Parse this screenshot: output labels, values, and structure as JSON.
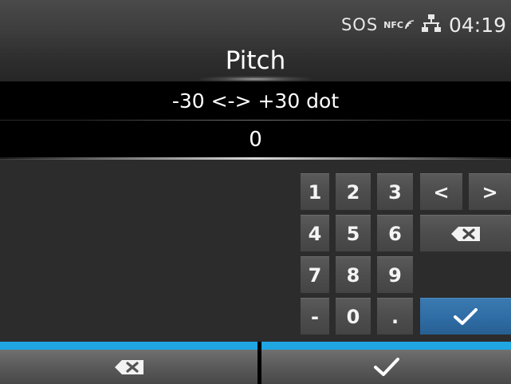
{
  "status": {
    "sos": "SOS",
    "nfc": "NFC",
    "clock": "04:19"
  },
  "title": "Pitch",
  "range": "-30 <-> +30 dot",
  "value": "0",
  "keypad": {
    "k1": "1",
    "k2": "2",
    "k3": "3",
    "k4": "4",
    "k5": "5",
    "k6": "6",
    "k7": "7",
    "k8": "8",
    "k9": "9",
    "minus": "-",
    "k0": "0",
    "dot": ".",
    "left": "<",
    "right": ">"
  },
  "icons": {
    "status": [
      "nfc-icon",
      "network-icon"
    ],
    "keypad": [
      "backspace-icon",
      "checkmark-icon"
    ],
    "bottom": [
      "backspace-icon",
      "checkmark-icon"
    ]
  },
  "colors": {
    "accent_blue": "#1fa6e3",
    "ok_key": "#2f6ea6"
  }
}
